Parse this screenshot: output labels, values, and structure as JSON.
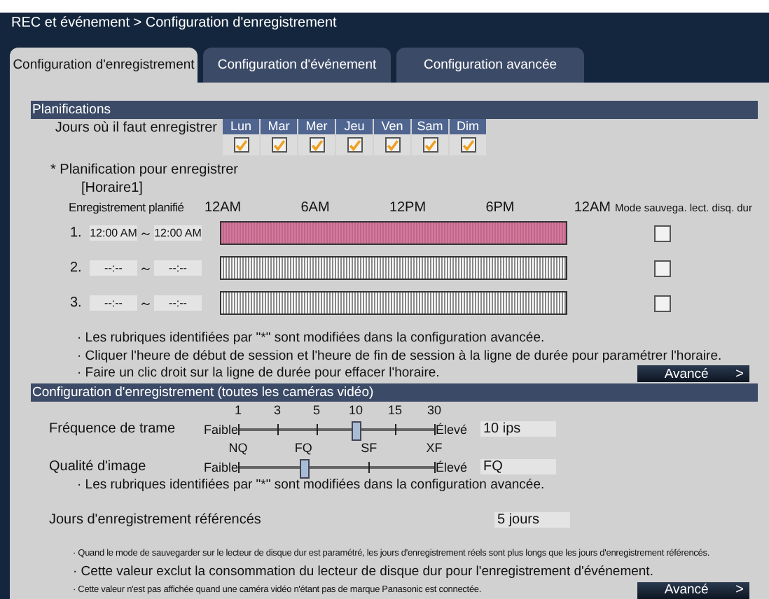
{
  "breadcrumb": "REC et événement > Configuration d'enregistrement",
  "tabs": [
    {
      "label": "Configuration d'enregistrement",
      "selected": true
    },
    {
      "label": "Configuration d'événement",
      "selected": false
    },
    {
      "label": "Configuration avancée",
      "selected": false
    }
  ],
  "schedules": {
    "title": "Planifications",
    "days_label": "Jours où il faut enregistrer",
    "days": [
      {
        "label": "Lun",
        "checked": true
      },
      {
        "label": "Mar",
        "checked": true
      },
      {
        "label": "Mer",
        "checked": true
      },
      {
        "label": "Jeu",
        "checked": true
      },
      {
        "label": "Ven",
        "checked": true
      },
      {
        "label": "Sam",
        "checked": true
      },
      {
        "label": "Dim",
        "checked": true
      }
    ],
    "plan_label": "* Planification pour enregistrer",
    "schedule_name": "[Horaire1]",
    "column_label": "Enregistrement planifié",
    "time_labels": [
      "12AM",
      "6AM",
      "12PM",
      "6PM",
      "12AM"
    ],
    "mode_label": "Mode sauvega. lect. disq. dur",
    "rows": [
      {
        "number": "1.",
        "start": "12:00 AM",
        "separator": "～",
        "end": "12:00 AM",
        "scheduled": true,
        "checked": false
      },
      {
        "number": "2.",
        "start": "--:--",
        "separator": "～",
        "end": "--:--",
        "scheduled": false,
        "checked": false
      },
      {
        "number": "3.",
        "start": "--:--",
        "separator": "～",
        "end": "--:--",
        "scheduled": false,
        "checked": false
      }
    ],
    "notes": [
      "· Les rubriques identifiées par \"*\" sont modifiées dans la configuration avancée.",
      "· Cliquer l'heure de début de session et l'heure de fin de session à la ligne de durée pour paramétrer l'horaire.",
      "· Faire un clic droit sur la ligne de durée pour effacer l'horaire."
    ],
    "advanced_button": {
      "label": "Avancé",
      "arrow": ">"
    }
  },
  "recording": {
    "title": "Configuration d'enregistrement (toutes les caméras vidéo)",
    "sliders": [
      {
        "label": "Fréquence de trame",
        "ticks": [
          "1",
          "3",
          "5",
          "10",
          "15",
          "30"
        ],
        "low": "Faible",
        "high": "Élevé",
        "level": 0.6,
        "value": "10 ips"
      },
      {
        "label": "Qualité d'image",
        "ticks": [
          "NQ",
          "FQ",
          "SF",
          "XF"
        ],
        "low": "Faible",
        "high": "Élevé",
        "level": 0.3333,
        "value": "FQ"
      }
    ],
    "note": "· Les rubriques identifiées par \"*\" sont modifiées dans la configuration avancée.",
    "days_label": "Jours d'enregistrement référencés",
    "days_value": "5 jours",
    "notes": [
      {
        "text": "· Quand le mode de sauvegarder sur le lecteur de disque dur est paramétré, les jours d'enregistrement réels sont plus longs que les jours d'enregistrement référencés.",
        "kind": "small"
      },
      {
        "text": "· Cette valeur exclut la consommation du lecteur de disque dur pour l'enregistrement d'événement.",
        "kind": "large"
      },
      {
        "text": "· Cette valeur n'est pas affichée quand une caméra vidéo n'étant pas de marque Panasonic est connectée.",
        "kind": "small"
      }
    ],
    "advanced_button": {
      "label": "Avancé",
      "arrow": ">"
    }
  }
}
